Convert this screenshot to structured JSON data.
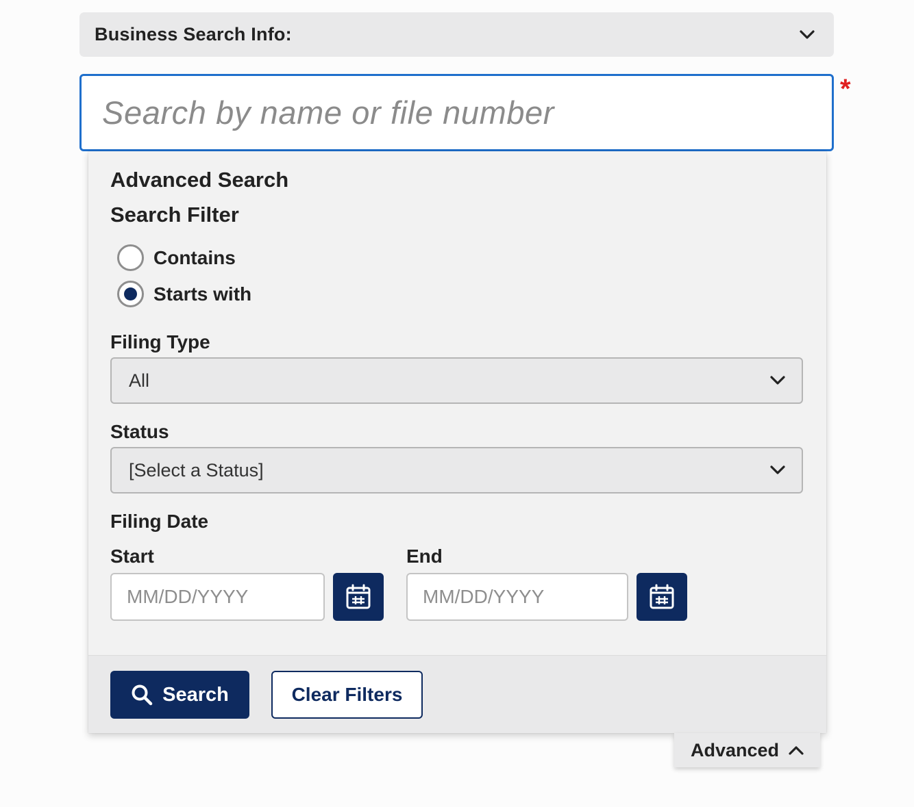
{
  "header": {
    "title": "Business Search Info:",
    "toggle_icon": "chevron-down-icon"
  },
  "search": {
    "placeholder": "Search by name or file number",
    "value": "",
    "required_marker": "*"
  },
  "advanced": {
    "title": "Advanced Search",
    "filter_title": "Search Filter",
    "filter_options": [
      {
        "label": "Contains",
        "selected": false
      },
      {
        "label": "Starts with",
        "selected": true
      }
    ],
    "filing_type": {
      "label": "Filing Type",
      "value": "All"
    },
    "status": {
      "label": "Status",
      "value": "[Select a Status]"
    },
    "filing_date": {
      "label": "Filing Date",
      "start": {
        "label": "Start",
        "placeholder": "MM/DD/YYYY",
        "value": ""
      },
      "end": {
        "label": "End",
        "placeholder": "MM/DD/YYYY",
        "value": ""
      },
      "calendar_icon": "calendar-icon"
    },
    "buttons": {
      "search": "Search",
      "clear": "Clear Filters"
    }
  },
  "advanced_toggle": {
    "label": "Advanced",
    "icon": "chevron-up-icon"
  },
  "colors": {
    "primary": "#0e2a5f",
    "focus_border": "#1f6fcc",
    "required": "#e02020",
    "panel_bg": "#f2f2f2",
    "header_bg": "#e9e9ea"
  }
}
